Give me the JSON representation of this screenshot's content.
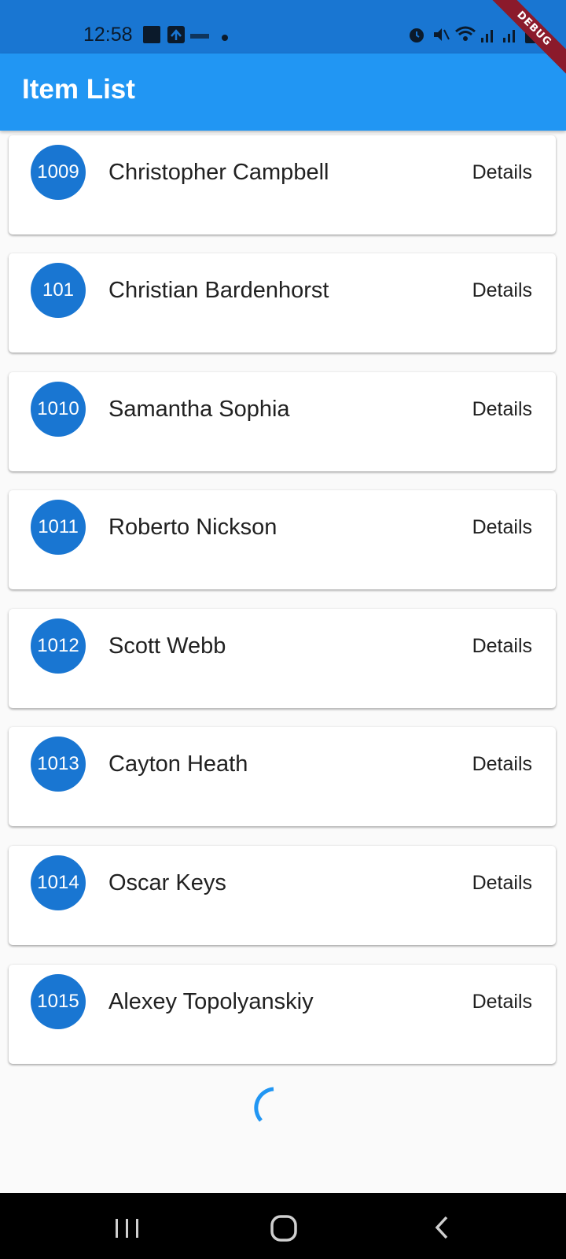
{
  "status_bar": {
    "time": "12:58",
    "left_icons": [
      "square-notification-icon",
      "upload-icon",
      "app-icon",
      "dot-icon"
    ],
    "right_icons": [
      "alarm-icon",
      "mute-icon",
      "wifi-icon",
      "signal-icon",
      "signal-icon",
      "battery-icon"
    ]
  },
  "app_bar": {
    "title": "Item List"
  },
  "debug_banner": "DEBUG",
  "items": [
    {
      "id": "1009",
      "name": "Christopher Campbell",
      "action": "Details"
    },
    {
      "id": "101",
      "name": "Christian Bardenhorst",
      "action": "Details"
    },
    {
      "id": "1010",
      "name": "Samantha Sophia",
      "action": "Details"
    },
    {
      "id": "1011",
      "name": "Roberto Nickson",
      "action": "Details"
    },
    {
      "id": "1012",
      "name": "Scott Webb",
      "action": "Details"
    },
    {
      "id": "1013",
      "name": "Cayton Heath",
      "action": "Details"
    },
    {
      "id": "1014",
      "name": "Oscar Keys",
      "action": "Details"
    },
    {
      "id": "1015",
      "name": "Alexey Topolyanskiy",
      "action": "Details"
    }
  ],
  "loading_indicator": "loading-spinner-icon",
  "nav_bar": [
    "recent-apps-icon",
    "home-icon",
    "back-icon"
  ],
  "colors": {
    "status_bar": "#1976d2",
    "app_bar": "#2196f3",
    "avatar": "#1976d2",
    "background": "#fafafa",
    "debug_ribbon": "#8b1a2b"
  }
}
